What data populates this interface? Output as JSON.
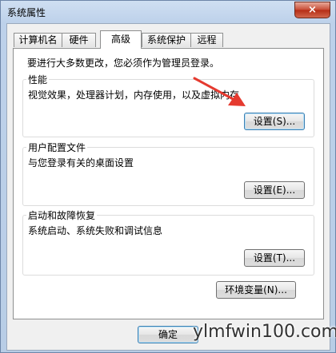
{
  "window": {
    "title": "系统属性",
    "close_symbol": "×"
  },
  "tabs": [
    {
      "label": "计算机名",
      "active": false
    },
    {
      "label": "硬件",
      "active": false
    },
    {
      "label": "高级",
      "active": true
    },
    {
      "label": "系统保护",
      "active": false
    },
    {
      "label": "远程",
      "active": false
    }
  ],
  "panel": {
    "admin_note": "要进行大多数更改，您必须作为管理员登录。",
    "performance": {
      "title": "性能",
      "description": "视觉效果，处理器计划，内存使用，以及虚拟内存",
      "button": "设置(S)..."
    },
    "user_profiles": {
      "title": "用户配置文件",
      "description": "与您登录有关的桌面设置",
      "button": "设置(E)..."
    },
    "startup_recovery": {
      "title": "启动和故障恢复",
      "description": "系统启动、系统失败和调试信息",
      "button": "设置(T)..."
    },
    "env_button": "环境变量(N)..."
  },
  "footer": {
    "ok_button": "确定"
  },
  "watermark": "ylmfwin100.com",
  "colors": {
    "annotation_arrow": "#e53a2f"
  }
}
